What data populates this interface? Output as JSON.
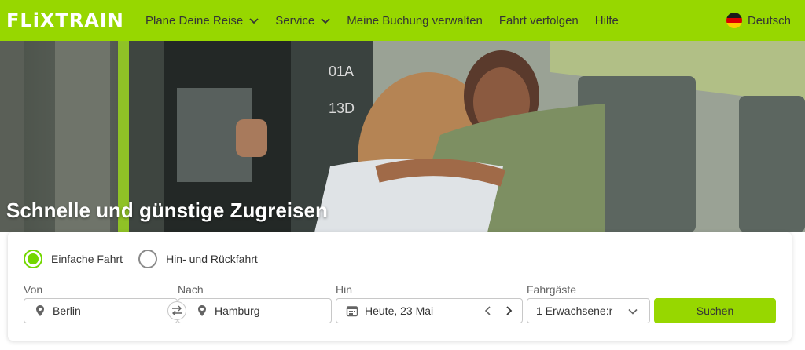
{
  "brand": {
    "logo_text": "FLiXTRAIN",
    "color": "#97d700",
    "accent": "#73d700"
  },
  "nav": {
    "items": [
      {
        "label": "Plane Deine Reise",
        "dropdown": true
      },
      {
        "label": "Service",
        "dropdown": true
      },
      {
        "label": "Meine Buchung verwalten",
        "dropdown": false
      },
      {
        "label": "Fahrt verfolgen",
        "dropdown": false
      },
      {
        "label": "Hilfe",
        "dropdown": false
      }
    ],
    "language": {
      "label": "Deutsch",
      "icon": "germany-flag-icon"
    }
  },
  "hero": {
    "title": "Schnelle und günstige Zugreisen"
  },
  "search": {
    "trip_types": [
      {
        "label": "Einfache Fahrt",
        "selected": true
      },
      {
        "label": "Hin- und Rückfahrt",
        "selected": false
      }
    ],
    "from": {
      "label": "Von",
      "value": "Berlin",
      "icon": "location-pin-icon"
    },
    "to": {
      "label": "Nach",
      "value": "Hamburg",
      "icon": "location-pin-icon"
    },
    "swap_icon": "swap-arrows-icon",
    "date": {
      "label": "Hin",
      "value": "Heute, 23 Mai",
      "icon": "calendar-icon"
    },
    "passengers": {
      "label": "Fahrgäste",
      "value": "1 Erwachsene:r",
      "icon": "chevron-down-icon"
    },
    "submit_label": "Suchen"
  }
}
